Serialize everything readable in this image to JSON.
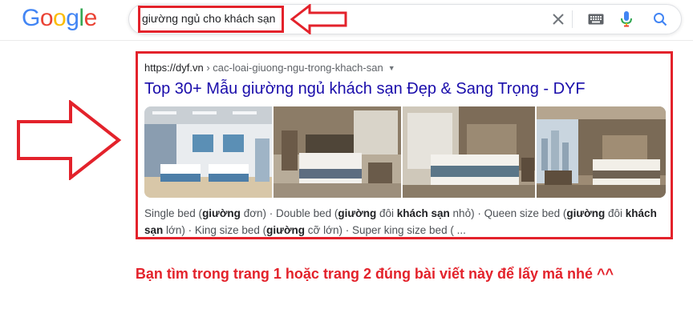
{
  "header": {
    "logo_text": "Google",
    "logo_letters": [
      {
        "ch": "G",
        "color": "#4285F4"
      },
      {
        "ch": "o",
        "color": "#EA4335"
      },
      {
        "ch": "o",
        "color": "#FBBC05"
      },
      {
        "ch": "g",
        "color": "#4285F4"
      },
      {
        "ch": "l",
        "color": "#34A853"
      },
      {
        "ch": "e",
        "color": "#EA4335"
      }
    ]
  },
  "search": {
    "query": "giường ngủ cho khách sạn",
    "icons": [
      "clear-icon",
      "keyboard-icon",
      "microphone-icon",
      "search-icon"
    ]
  },
  "result": {
    "domain": "https://dyf.vn",
    "path": " › cac-loai-giuong-ngu-trong-khach-san",
    "title": "Top 30+ Mẫu giường ngủ khách sạn Đẹp & Sang Trọng - DYF",
    "snippet_segments": [
      {
        "text": "Single bed (",
        "bold": false
      },
      {
        "text": "giường",
        "bold": true
      },
      {
        "text": " đơn) · Double bed (",
        "bold": false
      },
      {
        "text": "giường",
        "bold": true
      },
      {
        "text": " đôi ",
        "bold": false
      },
      {
        "text": "khách sạn",
        "bold": true
      },
      {
        "text": " nhỏ) · Queen size bed (",
        "bold": false
      },
      {
        "text": "giường",
        "bold": true
      },
      {
        "text": " đôi ",
        "bold": false
      },
      {
        "text": "khách sạn",
        "bold": true
      },
      {
        "text": " lớn) · King size bed (",
        "bold": false
      },
      {
        "text": "giường",
        "bold": true
      },
      {
        "text": " cỡ lớn) · Super king size bed ( ...",
        "bold": false
      }
    ],
    "thumbnails": [
      {
        "name": "hotel-room-twin-beds-image"
      },
      {
        "name": "hotel-room-double-bed-image"
      },
      {
        "name": "hotel-room-queen-bed-image"
      },
      {
        "name": "hotel-room-city-view-image"
      }
    ]
  },
  "annotations": {
    "highlight_color": "#e3222b",
    "instruction": "Bạn tìm trong trang 1 hoặc trang 2 đúng bài viết này để lấy mã nhé ^^"
  }
}
